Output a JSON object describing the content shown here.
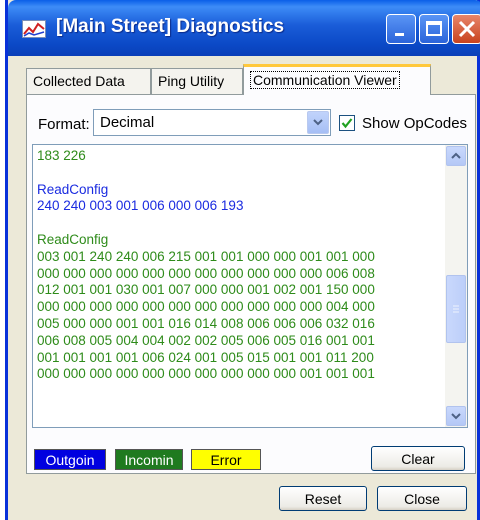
{
  "window": {
    "title": "[Main Street] Diagnostics",
    "icon": "chart-icon"
  },
  "tabs": [
    {
      "label": "Collected Data",
      "active": false
    },
    {
      "label": "Ping Utility",
      "active": false
    },
    {
      "label": "Communication Viewer",
      "active": true
    }
  ],
  "format": {
    "label": "Format:",
    "value": "Decimal"
  },
  "show_opcodes": {
    "label": "Show OpCodes",
    "checked": true
  },
  "log": [
    {
      "text": "183 226",
      "kind": "in"
    },
    {
      "text": "",
      "kind": "blank"
    },
    {
      "text": "ReadConfig",
      "kind": "out"
    },
    {
      "text": "240 240 003 001 006 000 006 193",
      "kind": "out"
    },
    {
      "text": "",
      "kind": "blank"
    },
    {
      "text": "ReadConfig",
      "kind": "in"
    },
    {
      "text": "003 001 240 240 006 215 001 001 000 000 001 001 000",
      "kind": "in"
    },
    {
      "text": "000 000 000 000 000 000 000 000 000 000 000 006 008",
      "kind": "in"
    },
    {
      "text": "012 001 001 030 001 007 000 000 001 002 001 150 000",
      "kind": "in"
    },
    {
      "text": "000 000 000 000 000 000 000 000 000 000 000 004 000",
      "kind": "in"
    },
    {
      "text": "005 000 000 001 001 016 014 008 006 006 006 032 016",
      "kind": "in"
    },
    {
      "text": "006 008 005 004 004 002 002 005 006 005 016 001 001",
      "kind": "in"
    },
    {
      "text": "001 001 001 001 006 024 001 005 015 001 001 011 200",
      "kind": "in"
    },
    {
      "text": "000 000 000 000 000 000 000 000 000 000 001 001 001",
      "kind": "in"
    }
  ],
  "legend": {
    "outgoing": "Outgoin",
    "incoming": "Incomin",
    "error": "Error"
  },
  "buttons": {
    "clear": "Clear",
    "reset": "Reset",
    "close": "Close"
  },
  "colors": {
    "incoming": "#2E8B1A",
    "outgoing": "#1A2BE0",
    "error": "#FFFF00",
    "active_tab_accent": "#FFC83C"
  }
}
